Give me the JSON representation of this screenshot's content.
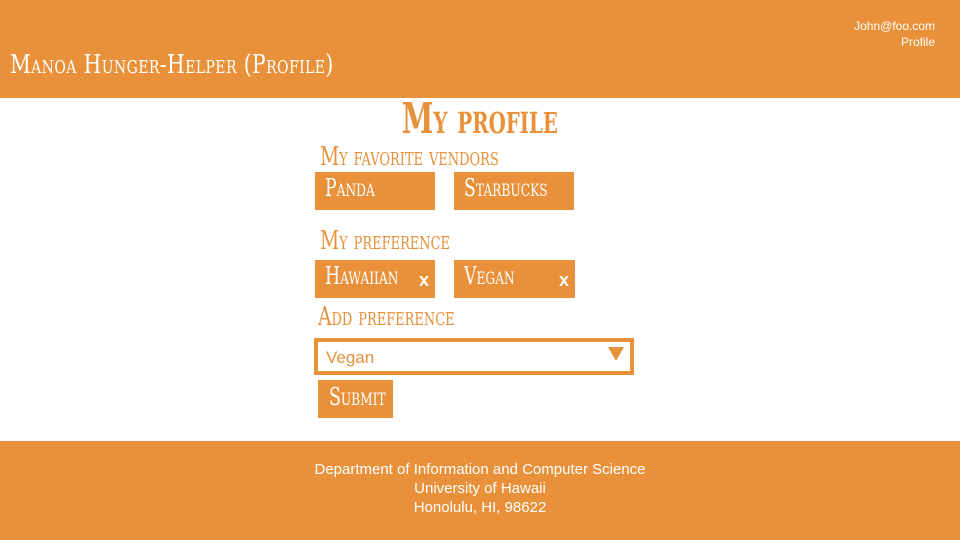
{
  "header": {
    "title": "Manoa Hunger-Helper (Profile)",
    "user_email": "John@foo.com",
    "profile_link": "Profile"
  },
  "main": {
    "title": "My profile",
    "favorite_vendors_label": "My favorite vendors",
    "favorite_vendors": [
      "Panda",
      "Starbucks"
    ],
    "preference_label": "My preference",
    "preferences": [
      {
        "label": "Hawaiian",
        "remove": "x"
      },
      {
        "label": "Vegan",
        "remove": "x"
      }
    ],
    "add_preference_label": "Add preference",
    "add_preference_select": {
      "selected": "Vegan"
    },
    "submit_label": "Submit"
  },
  "footer": {
    "line1": "Department of Information and Computer Science",
    "line2": "University of Hawaii",
    "line3": "Honolulu, HI, 98622"
  },
  "colors": {
    "accent": "#E8913A",
    "background": "#FFFFFF",
    "text_on_accent": "#FFFFFF"
  },
  "icons": {
    "select_arrow": "caret-down-icon",
    "remove": "close-icon"
  }
}
